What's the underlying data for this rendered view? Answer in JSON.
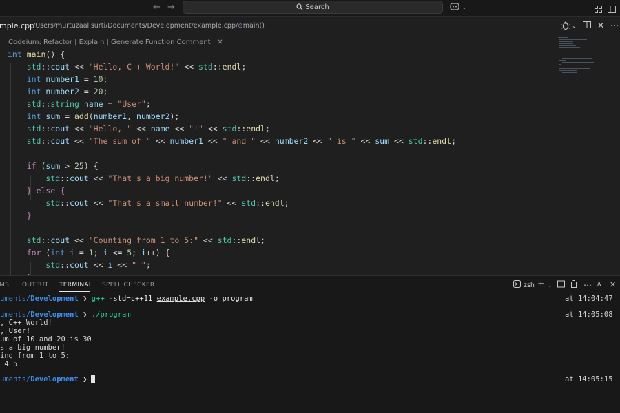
{
  "titlebar": {
    "search_label": "Search"
  },
  "breadcrumb": {
    "file_label": "mple.cpp",
    "path": "/Users/murtuzaalisurti/Documents/Development/example.cpp/",
    "symbol": "main()"
  },
  "editor": {
    "codelens": "Codeium: Refactor | Explain | Generate Function Comment | ✕",
    "code": {
      "l1": [
        "int",
        "main",
        "() {"
      ],
      "l2": [
        "std",
        "::",
        "cout",
        " << ",
        "\"Hello, C++ World!\"",
        " << ",
        "std",
        "::",
        "endl",
        ";"
      ],
      "l3": [
        "int",
        " ",
        "number1",
        " = ",
        "10",
        ";"
      ],
      "l4": [
        "int",
        " ",
        "number2",
        " = ",
        "20",
        ";"
      ],
      "l5": [
        "std",
        "::",
        "string",
        " ",
        "name",
        " = ",
        "\"User\"",
        ";"
      ],
      "l6": [
        "int",
        " ",
        "sum",
        " = ",
        "add",
        "(",
        "number1",
        ", ",
        "number2",
        ");"
      ],
      "l7": [
        "std",
        "::",
        "cout",
        " << ",
        "\"Hello, \"",
        " << ",
        "name",
        " << ",
        "\"!\"",
        " << ",
        "std",
        "::",
        "endl",
        ";"
      ],
      "l8": [
        "std",
        "::",
        "cout",
        " << ",
        "\"The sum of \"",
        " << ",
        "number1",
        " << ",
        "\" and \"",
        " << ",
        "number2",
        " << ",
        "\" is \"",
        " << ",
        "sum",
        " << ",
        "std",
        "::",
        "endl",
        ";"
      ],
      "l10": [
        "if",
        " (",
        "sum",
        " > ",
        "25",
        ") {"
      ],
      "l11": [
        "std",
        "::",
        "cout",
        " << ",
        "\"That's a big number!\"",
        " << ",
        "std",
        "::",
        "endl",
        ";"
      ],
      "l12": [
        "} ",
        "else",
        " {"
      ],
      "l13": [
        "std",
        "::",
        "cout",
        " << ",
        "\"That's a small number!\"",
        " << ",
        "std",
        "::",
        "endl",
        ";"
      ],
      "l14": [
        "}"
      ],
      "l16": [
        "std",
        "::",
        "cout",
        " << ",
        "\"Counting from 1 to 5:\"",
        " << ",
        "std",
        "::",
        "endl",
        ";"
      ],
      "l17": [
        "for",
        " (",
        "int",
        " ",
        "i",
        " = ",
        "1",
        "; ",
        "i",
        " <= ",
        "5",
        "; ",
        "i",
        "++) {"
      ],
      "l18": [
        "std",
        "::",
        "cout",
        " << ",
        "i",
        " << ",
        "\" \"",
        ";"
      ],
      "l19": [
        "}"
      ]
    }
  },
  "panel": {
    "tabs": [
      "MS",
      "OUTPUT",
      "TERMINAL",
      "SPELL CHECKER"
    ],
    "shell": "zsh"
  },
  "terminal": {
    "prompt_path": "uments/",
    "prompt_dir": "Development",
    "prompt_arrow": "❯",
    "cmd1": {
      "program": "g++",
      "pre_args": " -std=c++11 ",
      "file": "example.cpp",
      "post_args": " -o program",
      "time": "at 14:04:47"
    },
    "cmd2": {
      "text": "./program",
      "time": "at 14:05:08"
    },
    "output": [
      ", C++ World!",
      ", User!",
      "um of 10 and 20 is 30",
      "s a big number!",
      "ing from 1 to 5:",
      " 4 5"
    ],
    "time3": "at 14:05:15"
  },
  "colors": {
    "background": "#1f1f1f",
    "keyword": "#569cd6",
    "control": "#c586c0",
    "function": "#dcdcaa",
    "type_namespace": "#4ec9b0",
    "string": "#ce9178",
    "number": "#b5cea8",
    "variable": "#9cdcfe",
    "terminal_path": "#3b8eea",
    "terminal_command": "#23d18b"
  }
}
